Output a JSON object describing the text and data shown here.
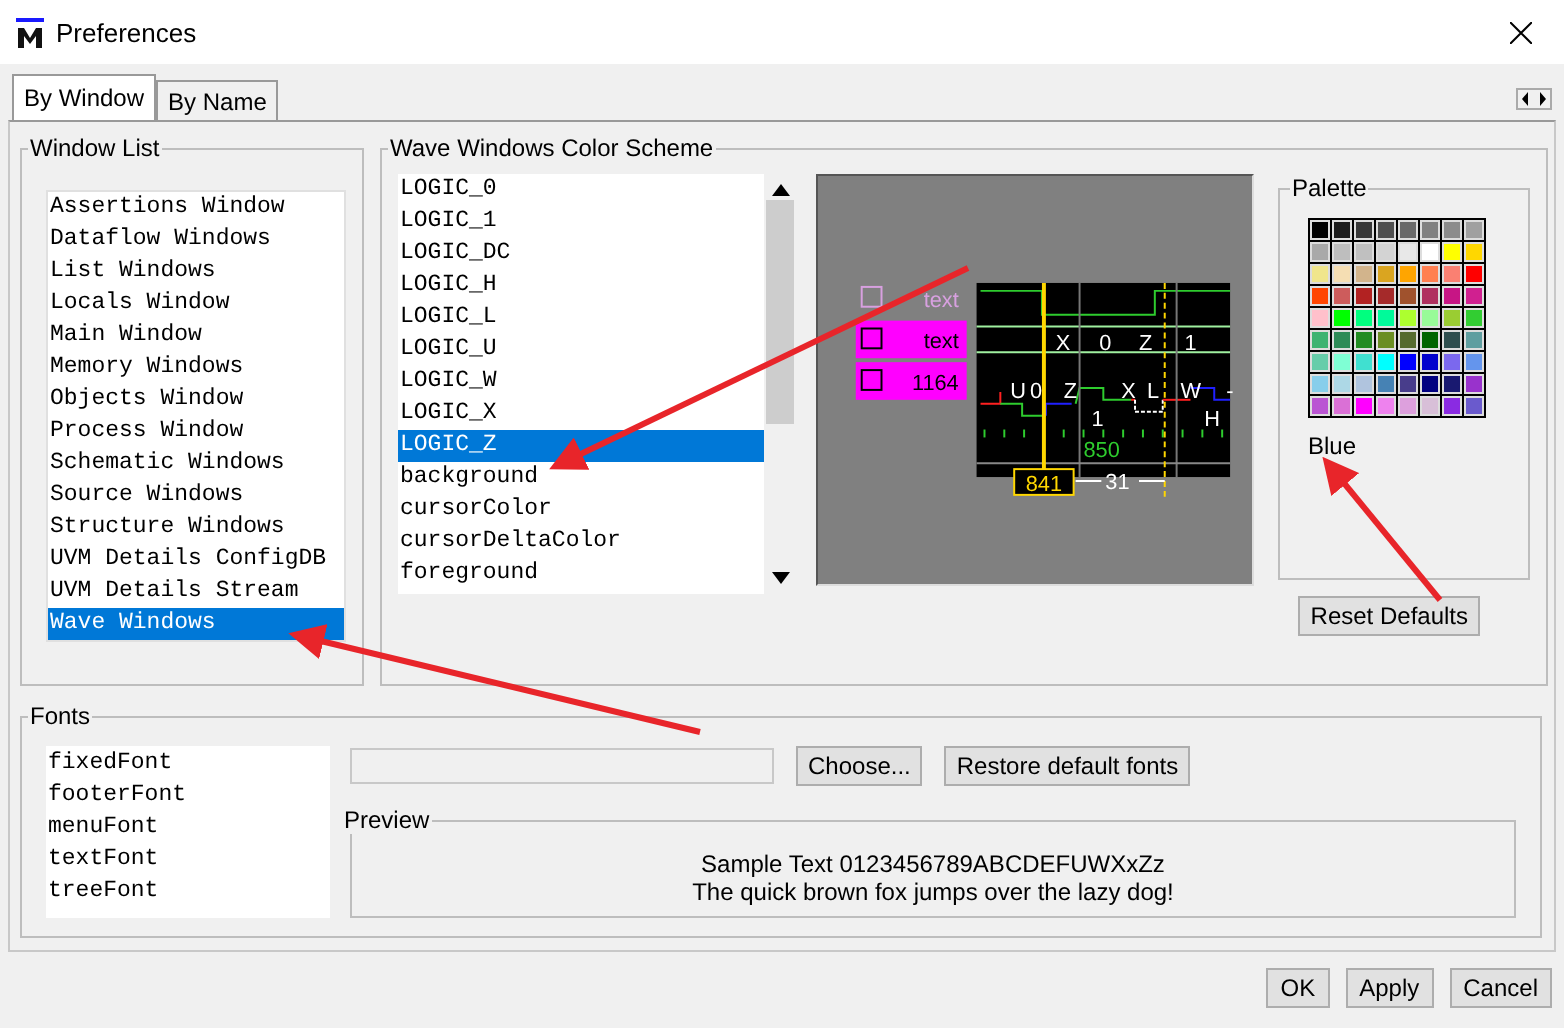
{
  "window": {
    "title": "Preferences"
  },
  "tabs": [
    {
      "label": "By Window",
      "selected": true
    },
    {
      "label": "By Name",
      "selected": false
    }
  ],
  "window_list": {
    "title": "Window List",
    "items": [
      {
        "label": "Assertions Window",
        "selected": false
      },
      {
        "label": "Dataflow Windows",
        "selected": false
      },
      {
        "label": "List Windows",
        "selected": false
      },
      {
        "label": "Locals Window",
        "selected": false
      },
      {
        "label": "Main Window",
        "selected": false
      },
      {
        "label": "Memory Windows",
        "selected": false
      },
      {
        "label": "Objects Window",
        "selected": false
      },
      {
        "label": "Process Window",
        "selected": false
      },
      {
        "label": "Schematic Windows",
        "selected": false
      },
      {
        "label": "Source Windows",
        "selected": false
      },
      {
        "label": "Structure Windows",
        "selected": false
      },
      {
        "label": "UVM Details ConfigDB",
        "selected": false
      },
      {
        "label": "UVM Details Stream",
        "selected": false
      },
      {
        "label": "Wave Windows",
        "selected": true
      }
    ]
  },
  "color_scheme": {
    "title": "Wave Windows Color Scheme",
    "items": [
      {
        "label": "LOGIC_0",
        "selected": false
      },
      {
        "label": "LOGIC_1",
        "selected": false
      },
      {
        "label": "LOGIC_DC",
        "selected": false
      },
      {
        "label": "LOGIC_H",
        "selected": false
      },
      {
        "label": "LOGIC_L",
        "selected": false
      },
      {
        "label": "LOGIC_U",
        "selected": false
      },
      {
        "label": "LOGIC_W",
        "selected": false
      },
      {
        "label": "LOGIC_X",
        "selected": false
      },
      {
        "label": "LOGIC_Z",
        "selected": true
      },
      {
        "label": "background",
        "selected": false
      },
      {
        "label": "cursorColor",
        "selected": false
      },
      {
        "label": "cursorDeltaColor",
        "selected": false
      },
      {
        "label": "foreground",
        "selected": false
      }
    ],
    "preview": {
      "legend": [
        {
          "label": "text",
          "highlighted": false
        },
        {
          "label": "text",
          "highlighted": true
        },
        {
          "label": "1164",
          "highlighted": true
        }
      ],
      "bus_values": [
        "X",
        "0",
        "Z",
        "1"
      ],
      "signal_values": [
        "U",
        "0",
        "Z",
        "X",
        "L",
        "W",
        "-"
      ],
      "lower_values": [
        "1",
        "H"
      ],
      "ruler_label": "850",
      "cursor_label": "841",
      "delta_label": "31"
    },
    "palette": {
      "title": "Palette",
      "color_name": "Blue",
      "swatches": [
        {
          "color": "#000000"
        },
        {
          "color": "#1c1c1c"
        },
        {
          "color": "#383838"
        },
        {
          "color": "#4f4f4f"
        },
        {
          "color": "#696969"
        },
        {
          "color": "#808080"
        },
        {
          "color": "#8c8c8c"
        },
        {
          "color": "#a0a0a0"
        },
        {
          "color": "#a9a9a9"
        },
        {
          "color": "#bebebe"
        },
        {
          "color": "#c0c0c0"
        },
        {
          "color": "#d3d3d3"
        },
        {
          "color": "#e8e8e8"
        },
        {
          "color": "#ffffff"
        },
        {
          "color": "#ffff00"
        },
        {
          "color": "#ffd700"
        },
        {
          "color": "#f0e68c"
        },
        {
          "color": "#f5deb3"
        },
        {
          "color": "#d2b48c"
        },
        {
          "color": "#daa520"
        },
        {
          "color": "#ffa500"
        },
        {
          "color": "#ff7f50"
        },
        {
          "color": "#fa8072"
        },
        {
          "color": "#ff0000"
        },
        {
          "color": "#ff4500"
        },
        {
          "color": "#cd5c5c"
        },
        {
          "color": "#b22222"
        },
        {
          "color": "#a52a2a"
        },
        {
          "color": "#a0522d"
        },
        {
          "color": "#b03060"
        },
        {
          "color": "#c71585"
        },
        {
          "color": "#d02090"
        },
        {
          "color": "#ffc0cb"
        },
        {
          "color": "#00ff00"
        },
        {
          "color": "#00ff7f"
        },
        {
          "color": "#00fa9a"
        },
        {
          "color": "#adff2f"
        },
        {
          "color": "#98fb98"
        },
        {
          "color": "#9acd32"
        },
        {
          "color": "#32cd32"
        },
        {
          "color": "#3cb371"
        },
        {
          "color": "#2e8b57"
        },
        {
          "color": "#228b22"
        },
        {
          "color": "#6b8e23"
        },
        {
          "color": "#556b2f"
        },
        {
          "color": "#006400"
        },
        {
          "color": "#2f4f4f"
        },
        {
          "color": "#5f9ea0"
        },
        {
          "color": "#66cdaa"
        },
        {
          "color": "#7fffd4"
        },
        {
          "color": "#40e0d0"
        },
        {
          "color": "#00ffff"
        },
        {
          "color": "#0000ff"
        },
        {
          "color": "#0000cd"
        },
        {
          "color": "#7b68ee"
        },
        {
          "color": "#6495ed"
        },
        {
          "color": "#87ceeb"
        },
        {
          "color": "#add8e6"
        },
        {
          "color": "#b0c4de"
        },
        {
          "color": "#4682b4"
        },
        {
          "color": "#483d8b"
        },
        {
          "color": "#000080"
        },
        {
          "color": "#191970"
        },
        {
          "color": "#9932cc"
        },
        {
          "color": "#ba55d3"
        },
        {
          "color": "#da70d6"
        },
        {
          "color": "#ff00ff"
        },
        {
          "color": "#ee82ee"
        },
        {
          "color": "#dda0dd"
        },
        {
          "color": "#d8bfd8"
        },
        {
          "color": "#8a2be2"
        },
        {
          "color": "#6a5acd"
        }
      ]
    },
    "reset_button": "Reset Defaults"
  },
  "fonts": {
    "title": "Fonts",
    "items": [
      {
        "label": "fixedFont",
        "selected": false
      },
      {
        "label": "footerFont",
        "selected": false
      },
      {
        "label": "menuFont",
        "selected": false
      },
      {
        "label": "textFont",
        "selected": false
      },
      {
        "label": "treeFont",
        "selected": false
      }
    ],
    "choose_button": "Choose...",
    "restore_button": "Restore default fonts",
    "preview": {
      "title": "Preview",
      "lines": [
        "Sample Text 0123456789ABCDEFUWXxZz",
        "The quick brown fox jumps over the lazy dog!"
      ]
    }
  },
  "buttons": [
    "OK",
    "Apply",
    "Cancel"
  ]
}
